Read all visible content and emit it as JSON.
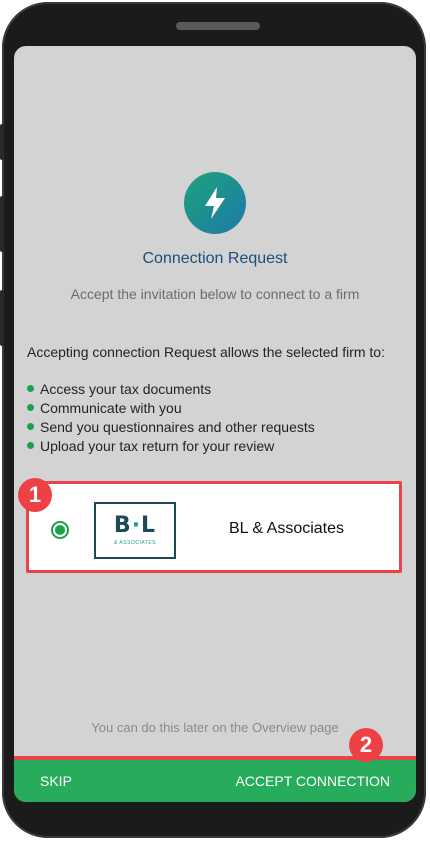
{
  "connection": {
    "title": "Connection Request",
    "subtitle": "Accept the invitation below to connect to a firm",
    "intro": "Accepting connection Request allows the selected firm to:",
    "permissions": [
      "Access your tax documents",
      "Communicate with you",
      "Send you questionnaires and other requests",
      "Upload your tax return for your review"
    ]
  },
  "firm": {
    "name": "BL & Associates",
    "logo_text_left": "B",
    "logo_text_mid": "·",
    "logo_text_right": "L",
    "logo_sub": "& ASSOCIATES",
    "selected": true
  },
  "annotations": {
    "badge1": "1",
    "badge2": "2"
  },
  "footer": {
    "later_note": "You can do this later on the Overview page",
    "skip_label": "SKIP",
    "accept_label": "ACCEPT CONNECTION"
  },
  "colors": {
    "accent_green": "#27ac5c",
    "title_blue": "#1c4e7b",
    "highlight_red": "#e8424a"
  },
  "icons": [
    "lightning-icon",
    "radio-selected-icon",
    "firm-logo"
  ]
}
